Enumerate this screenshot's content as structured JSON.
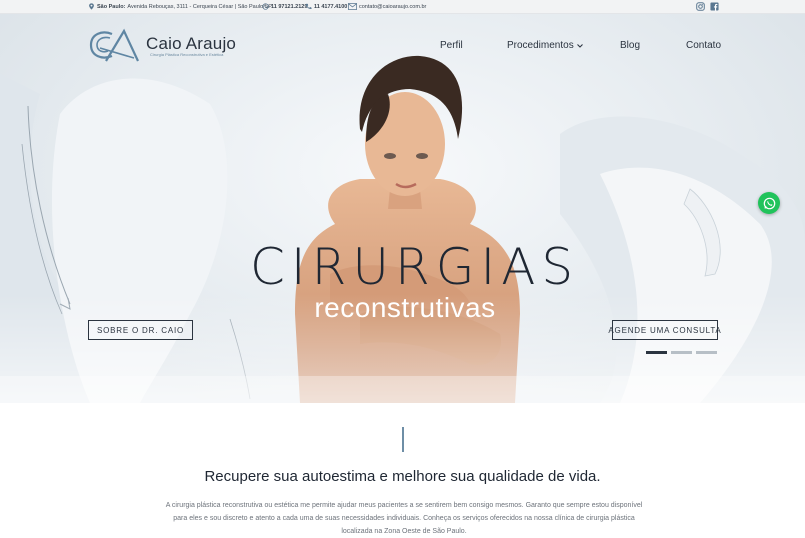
{
  "topbar": {
    "address_city": "São Paulo:",
    "address": "Avenida Rebouças, 3111 - Cerqueira César | São Paulo/SP",
    "whatsapp": "11 97121.2129",
    "phone": "11 4177.4100",
    "email": "contato@caioaraujo.com.br"
  },
  "brand": {
    "name": "Caio Araujo",
    "tagline": "Cirurgia Plástica Reconstrutiva e Estética",
    "accent_color": "#5f86a3"
  },
  "nav": {
    "items": [
      {
        "label": "Perfil"
      },
      {
        "label": "Procedimentos"
      },
      {
        "label": "Blog"
      },
      {
        "label": "Contato"
      }
    ]
  },
  "hero": {
    "title": "CIRURGIAS",
    "subtitle": "reconstrutivas",
    "btn_left": "Sobre o Dr. Caio",
    "btn_right": "Agende uma consulta",
    "slides_total": 3,
    "active_slide": 1
  },
  "intro": {
    "headline": "Recupere sua autoestima e melhore sua qualidade de vida.",
    "paragraph": "A cirurgia plástica reconstrutiva ou estética me permite ajudar meus pacientes a se sentirem bem consigo mesmos. Garanto que sempre estou disponível para eles e sou discreto e atento a cada uma de suas necessidades individuais. Conheça os serviços oferecidos na nossa clínica de cirurgia plástica localizada na Zona Oeste de São Paulo."
  }
}
